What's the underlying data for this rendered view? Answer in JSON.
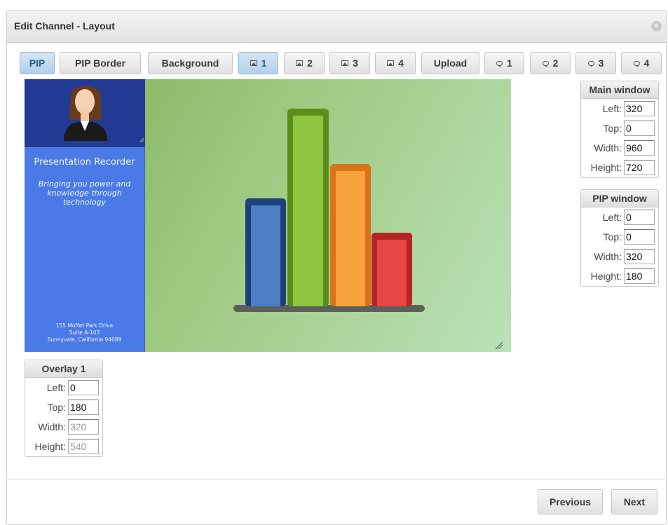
{
  "dialog": {
    "title": "Edit Channel - Layout"
  },
  "tabs": [
    {
      "label": "PIP",
      "icon": "",
      "active": true
    },
    {
      "label": "PIP Border",
      "icon": ""
    },
    {
      "label": "Background",
      "icon": ""
    },
    {
      "label": "1",
      "icon": "image-icon",
      "active": true
    },
    {
      "label": "2",
      "icon": "image-icon"
    },
    {
      "label": "3",
      "icon": "image-icon"
    },
    {
      "label": "4",
      "icon": "image-icon"
    },
    {
      "label": "Upload",
      "icon": ""
    },
    {
      "label": "1",
      "icon": "speech-bubble-icon"
    },
    {
      "label": "2",
      "icon": "speech-bubble-icon"
    },
    {
      "label": "3",
      "icon": "speech-bubble-icon"
    },
    {
      "label": "4",
      "icon": "speech-bubble-icon"
    }
  ],
  "preview": {
    "overlay": {
      "title": "Presentation Recorder",
      "tagline": "Bringing you power and knowledge through technology",
      "address_line1": "155 Moffet Park Drive",
      "address_line2": "Suite A-103",
      "address_line3": "Sunnyvale, California 94089"
    }
  },
  "main_window": {
    "header": "Main window",
    "fields": [
      {
        "label": "Left:",
        "value": "320"
      },
      {
        "label": "Top:",
        "value": "0"
      },
      {
        "label": "Width:",
        "value": "960"
      },
      {
        "label": "Height:",
        "value": "720"
      }
    ]
  },
  "pip_window": {
    "header": "PIP window",
    "fields": [
      {
        "label": "Left:",
        "value": "0"
      },
      {
        "label": "Top:",
        "value": "0"
      },
      {
        "label": "Width:",
        "value": "320"
      },
      {
        "label": "Height:",
        "value": "180"
      }
    ]
  },
  "overlay_panel": {
    "header": "Overlay 1",
    "fields": [
      {
        "label": "Left:",
        "value": "0"
      },
      {
        "label": "Top:",
        "value": "180"
      },
      {
        "label": "Width:",
        "value": "320",
        "disabled": true
      },
      {
        "label": "Height:",
        "value": "540",
        "disabled": true
      }
    ]
  },
  "footer": {
    "previous": "Previous",
    "next": "Next"
  },
  "colors": {
    "accent_tab": "#b4d0ea",
    "overlay_bg": "#4a7ae6",
    "pip_bg": "#223a93"
  }
}
